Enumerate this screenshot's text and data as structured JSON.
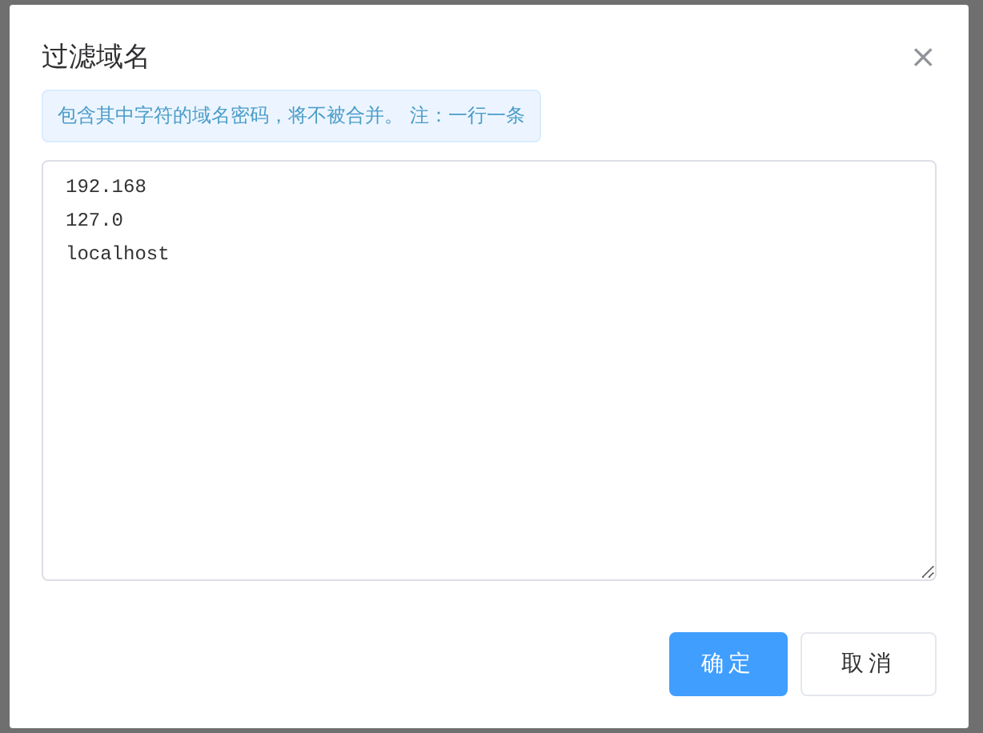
{
  "dialog": {
    "title": "过滤域名",
    "close": "×",
    "notice": "包含其中字符的域名密码，将不被合并。 注：一行一条",
    "lines": [
      "192.168",
      "127.0",
      "localhost"
    ],
    "buttons": [
      {
        "label": "确定",
        "kind": "primary"
      },
      {
        "label": "取消",
        "kind": "default"
      }
    ]
  }
}
